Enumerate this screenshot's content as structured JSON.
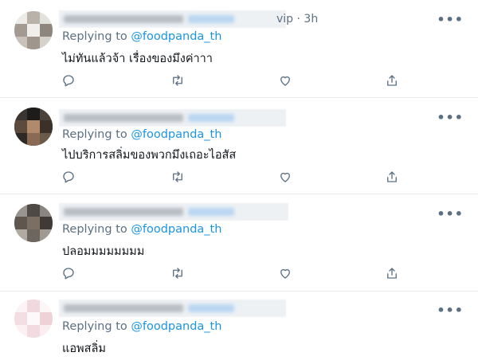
{
  "tweets": [
    {
      "meta": "vip · 3h",
      "replying_prefix": "Replying to",
      "reply_handle": "@foodpanda_th",
      "text": "ไม่ทันแล้วจ้า เรื่องของมึงค่าาา",
      "more_icon": "more-horizontal-icon"
    },
    {
      "meta": "",
      "replying_prefix": "Replying to",
      "reply_handle": "@foodpanda_th",
      "text": "ไปบริการสลิ่มของพวกมึงเถอะไอสัส",
      "more_icon": "more-horizontal-icon"
    },
    {
      "meta": "",
      "replying_prefix": "Replying to",
      "reply_handle": "@foodpanda_th",
      "text": "ปลอมมมมมมมม",
      "more_icon": "more-horizontal-icon"
    },
    {
      "meta": "",
      "replying_prefix": "Replying to",
      "reply_handle": "@foodpanda_th",
      "text": "แอพสลิ่ม",
      "more_icon": "more-horizontal-icon"
    }
  ],
  "more_glyph": "•••",
  "colors": {
    "secondary_text": "#5b7083",
    "link": "#1b95e0",
    "primary_text": "#0f1419",
    "divider": "#e6ecf0"
  }
}
